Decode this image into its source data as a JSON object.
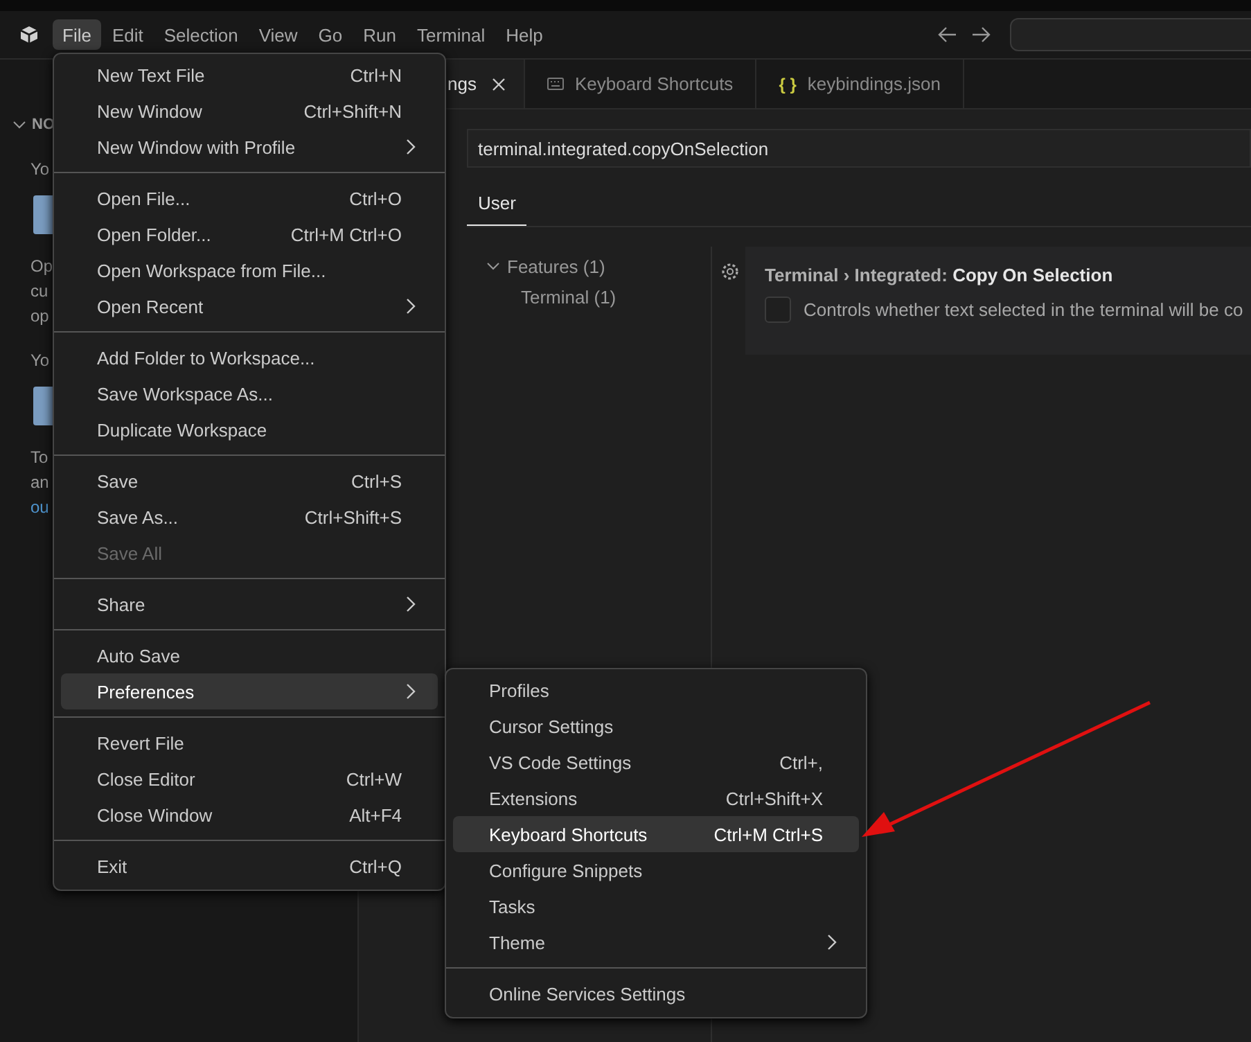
{
  "menubar": {
    "items": [
      {
        "label": "File",
        "selected": true
      },
      {
        "label": "Edit",
        "selected": false
      },
      {
        "label": "Selection",
        "selected": false
      },
      {
        "label": "View",
        "selected": false
      },
      {
        "label": "Go",
        "selected": false
      },
      {
        "label": "Run",
        "selected": false
      },
      {
        "label": "Terminal",
        "selected": false
      },
      {
        "label": "Help",
        "selected": false
      }
    ]
  },
  "sidebar": {
    "header": "NO",
    "lines": [
      {
        "kind": "text",
        "text": "Yo"
      },
      {
        "kind": "button"
      },
      {
        "kind": "text",
        "text": "Op"
      },
      {
        "kind": "text",
        "text": "cu"
      },
      {
        "kind": "text",
        "text": "op"
      },
      {
        "kind": "text",
        "text": "Yo"
      },
      {
        "kind": "button"
      },
      {
        "kind": "text",
        "text": "To"
      },
      {
        "kind": "text",
        "text": "an"
      },
      {
        "kind": "link",
        "text": "ou"
      }
    ]
  },
  "editor": {
    "tabs": [
      {
        "kind": "settings",
        "label": "ngs",
        "closable": true,
        "selected": true
      },
      {
        "kind": "shortcuts",
        "label": "Keyboard Shortcuts",
        "closable": false,
        "selected": false
      },
      {
        "kind": "json",
        "label": "keybindings.json",
        "icon_text": "{ }",
        "closable": false,
        "selected": false
      }
    ],
    "search": {
      "value": "terminal.integrated.copyOnSelection"
    },
    "scope_tabs": [
      {
        "label": "User",
        "selected": true
      }
    ],
    "toc": [
      {
        "label": "Features (1)",
        "expanded": true,
        "children": [
          {
            "label": "Terminal (1)"
          }
        ]
      }
    ],
    "setting": {
      "category": "Terminal › Integrated: ",
      "name": "Copy On Selection",
      "checked": false,
      "description": "Controls whether text selected in the terminal will be co"
    }
  },
  "file_menu": {
    "items": [
      {
        "kind": "item",
        "label": "New Text File",
        "shortcut": "Ctrl+N",
        "submenu": false,
        "disabled": false,
        "selected": false
      },
      {
        "kind": "item",
        "label": "New Window",
        "shortcut": "Ctrl+Shift+N",
        "submenu": false,
        "disabled": false,
        "selected": false
      },
      {
        "kind": "item",
        "label": "New Window with Profile",
        "submenu": true,
        "disabled": false,
        "selected": false
      },
      {
        "kind": "separator"
      },
      {
        "kind": "item",
        "label": "Open File...",
        "shortcut": "Ctrl+O",
        "submenu": false,
        "disabled": false,
        "selected": false
      },
      {
        "kind": "item",
        "label": "Open Folder...",
        "shortcut": "Ctrl+M Ctrl+O",
        "submenu": false,
        "disabled": false,
        "selected": false
      },
      {
        "kind": "item",
        "label": "Open Workspace from File...",
        "submenu": false,
        "disabled": false,
        "selected": false
      },
      {
        "kind": "item",
        "label": "Open Recent",
        "submenu": true,
        "disabled": false,
        "selected": false
      },
      {
        "kind": "separator"
      },
      {
        "kind": "item",
        "label": "Add Folder to Workspace...",
        "submenu": false,
        "disabled": false,
        "selected": false
      },
      {
        "kind": "item",
        "label": "Save Workspace As...",
        "submenu": false,
        "disabled": false,
        "selected": false
      },
      {
        "kind": "item",
        "label": "Duplicate Workspace",
        "submenu": false,
        "disabled": false,
        "selected": false
      },
      {
        "kind": "separator"
      },
      {
        "kind": "item",
        "label": "Save",
        "shortcut": "Ctrl+S",
        "submenu": false,
        "disabled": false,
        "selected": false
      },
      {
        "kind": "item",
        "label": "Save As...",
        "shortcut": "Ctrl+Shift+S",
        "submenu": false,
        "disabled": false,
        "selected": false
      },
      {
        "kind": "item",
        "label": "Save All",
        "submenu": false,
        "disabled": true,
        "selected": false
      },
      {
        "kind": "separator"
      },
      {
        "kind": "item",
        "label": "Share",
        "submenu": true,
        "disabled": false,
        "selected": false
      },
      {
        "kind": "separator"
      },
      {
        "kind": "item",
        "label": "Auto Save",
        "submenu": false,
        "disabled": false,
        "selected": false
      },
      {
        "kind": "item",
        "label": "Preferences",
        "submenu": true,
        "disabled": false,
        "selected": true
      },
      {
        "kind": "separator"
      },
      {
        "kind": "item",
        "label": "Revert File",
        "submenu": false,
        "disabled": false,
        "selected": false
      },
      {
        "kind": "item",
        "label": "Close Editor",
        "shortcut": "Ctrl+W",
        "submenu": false,
        "disabled": false,
        "selected": false
      },
      {
        "kind": "item",
        "label": "Close Window",
        "shortcut": "Alt+F4",
        "submenu": false,
        "disabled": false,
        "selected": false
      },
      {
        "kind": "separator"
      },
      {
        "kind": "item",
        "label": "Exit",
        "shortcut": "Ctrl+Q",
        "submenu": false,
        "disabled": false,
        "selected": false
      }
    ]
  },
  "preferences_menu": {
    "items": [
      {
        "kind": "item",
        "label": "Profiles",
        "submenu": false,
        "disabled": false,
        "selected": false
      },
      {
        "kind": "item",
        "label": "Cursor Settings",
        "submenu": false,
        "disabled": false,
        "selected": false
      },
      {
        "kind": "item",
        "label": "VS Code Settings",
        "shortcut": "Ctrl+,",
        "submenu": false,
        "disabled": false,
        "selected": false
      },
      {
        "kind": "item",
        "label": "Extensions",
        "shortcut": "Ctrl+Shift+X",
        "submenu": false,
        "disabled": false,
        "selected": false
      },
      {
        "kind": "item",
        "label": "Keyboard Shortcuts",
        "shortcut": "Ctrl+M Ctrl+S",
        "submenu": false,
        "disabled": false,
        "selected": true
      },
      {
        "kind": "item",
        "label": "Configure Snippets",
        "submenu": false,
        "disabled": false,
        "selected": false
      },
      {
        "kind": "item",
        "label": "Tasks",
        "submenu": false,
        "disabled": false,
        "selected": false
      },
      {
        "kind": "item",
        "label": "Theme",
        "submenu": true,
        "disabled": false,
        "selected": false
      },
      {
        "kind": "separator"
      },
      {
        "kind": "item",
        "label": "Online Services Settings",
        "submenu": false,
        "disabled": false,
        "selected": false
      }
    ]
  }
}
